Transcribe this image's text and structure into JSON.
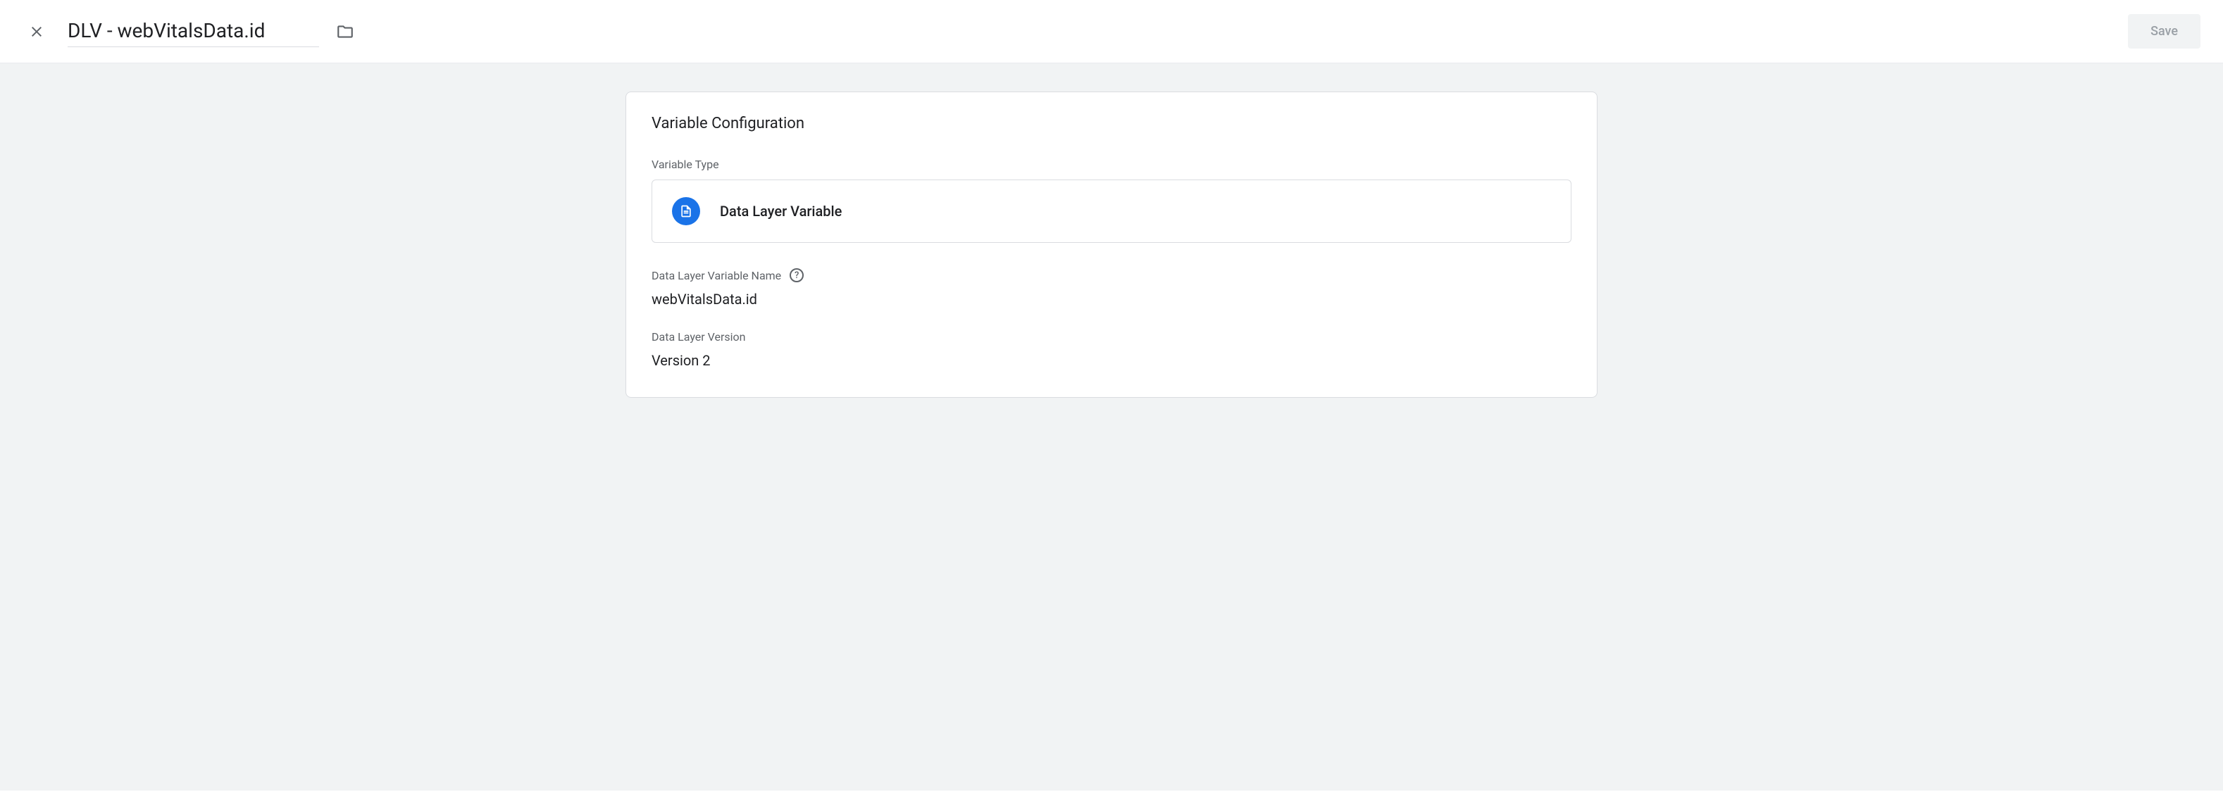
{
  "header": {
    "title": "DLV - webVitalsData.id",
    "save_label": "Save"
  },
  "card": {
    "title": "Variable Configuration",
    "type_label": "Variable Type",
    "type_value": "Data Layer Variable",
    "var_name_label": "Data Layer Variable Name",
    "var_name_value": "webVitalsData.id",
    "version_label": "Data Layer Version",
    "version_value": "Version 2",
    "help_char": "?"
  }
}
